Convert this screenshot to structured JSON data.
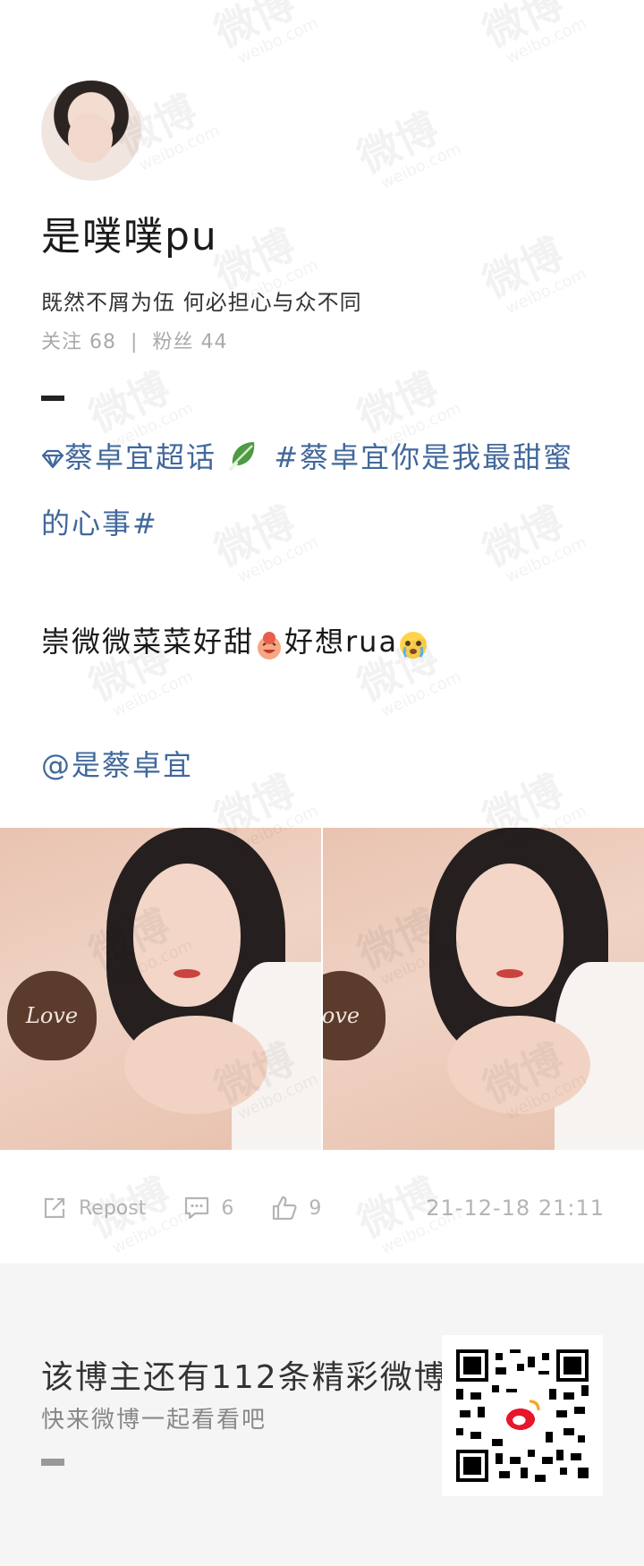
{
  "profile": {
    "name": "是噗噗pu",
    "bio": "既然不屑为伍 何必担心与众不同",
    "following_label": "关注",
    "following_count": "68",
    "separator": "|",
    "followers_label": "粉丝",
    "followers_count": "44"
  },
  "post": {
    "supertopic": "蔡卓宜超话",
    "hashtag_line1": "#蔡卓宜你是我最甜蜜",
    "hashtag_line2": "的心事#",
    "text": "崇微微菜菜好甜",
    "text2": "好想rua",
    "mention": "@是蔡卓宜",
    "photo_label": "Love",
    "photo_label_cropped": "ove"
  },
  "actions": {
    "repost_label": "Repost",
    "comment_count": "6",
    "like_count": "9",
    "timestamp": "21-12-18 21:11"
  },
  "footer": {
    "title": "该博主还有112条精彩微博",
    "subtitle": "快来微博一起看看吧"
  },
  "watermark": {
    "brand": "微博",
    "domain": "weibo.com"
  },
  "colors": {
    "link": "#41689b",
    "muted": "#b5b5b5",
    "footer_bg": "#f5f5f5"
  }
}
